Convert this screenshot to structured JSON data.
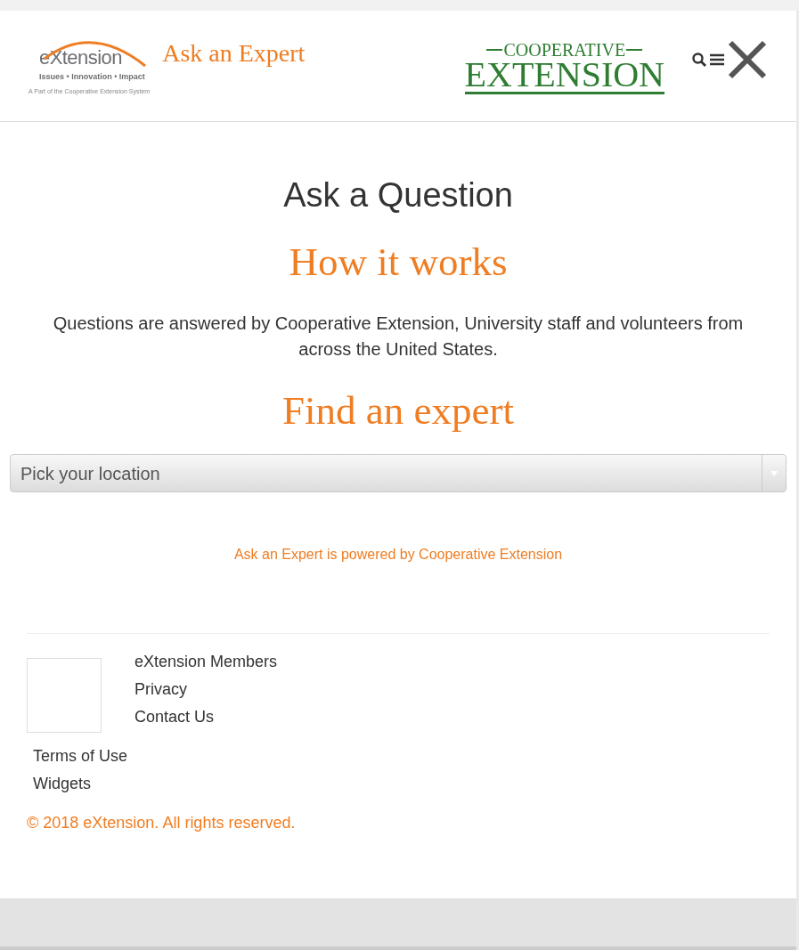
{
  "header": {
    "logo": {
      "wordmark": "eXtension",
      "tagline": "Issues • Innovation • Impact",
      "subline": "A Part of the Cooperative Extension System"
    },
    "site_title": "Ask an Expert",
    "partner_logo": {
      "top": "COOPERATIVE",
      "bottom": "EXTENSION"
    }
  },
  "main": {
    "title": "Ask a Question",
    "how_heading": "How it works",
    "how_text": "Questions are answered by Cooperative Extension, University staff and volunteers from across the United States.",
    "find_heading": "Find an expert",
    "location_select": {
      "value": "Pick your location"
    },
    "powered_by": "Ask an Expert is powered by Cooperative Extension"
  },
  "footer": {
    "side_links": [
      "eXtension Members",
      "Privacy",
      "Contact Us"
    ],
    "links": [
      "Terms of Use",
      "Widgets"
    ],
    "copyright": "© 2018 eXtension. All rights reserved."
  }
}
